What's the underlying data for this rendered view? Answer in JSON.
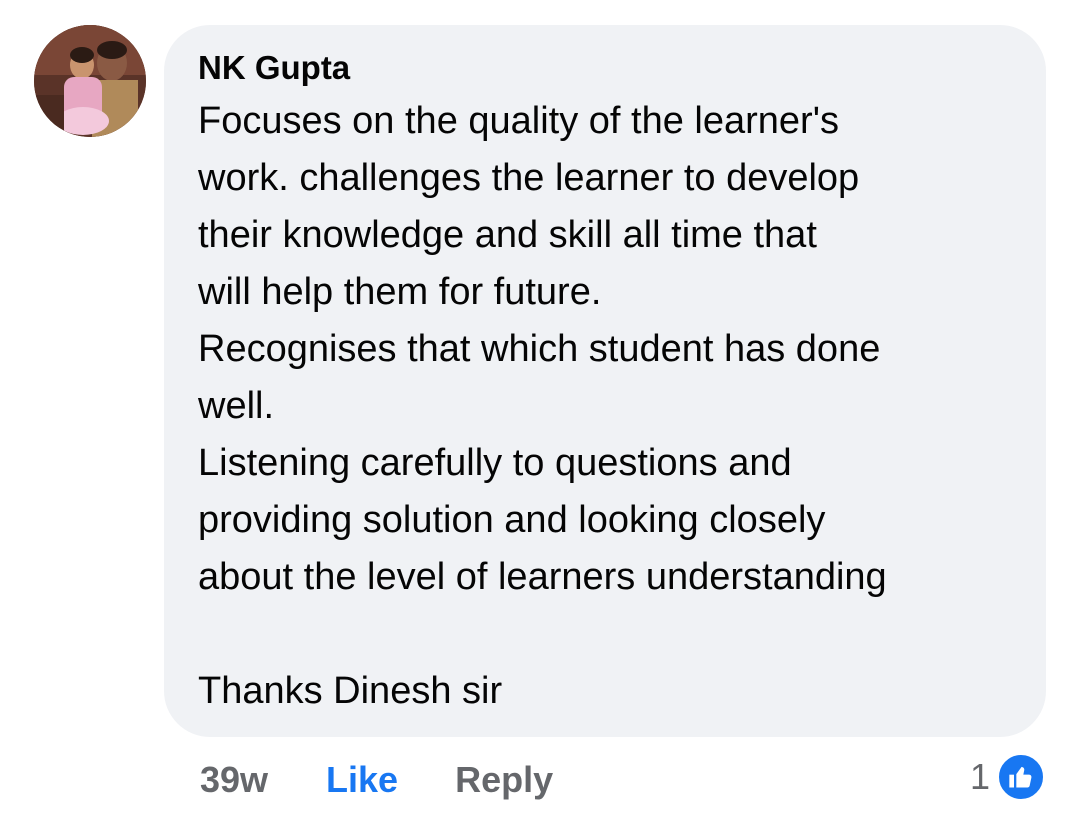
{
  "comment": {
    "author": "NK Gupta",
    "body_lines": [
      "Focuses on the quality of the learner's",
      "work. challenges the learner to develop",
      "their knowledge and skill all time that",
      "will help them for future.",
      "Recognises that which student has done",
      "well.",
      "Listening carefully to questions and",
      "providing solution and looking closely",
      "about the level of learners understanding",
      "",
      "Thanks Dinesh sir"
    ],
    "timestamp": "39w",
    "like_label": "Like",
    "reply_label": "Reply",
    "reaction_count": "1",
    "reaction_icon": "thumbs-up-icon"
  },
  "colors": {
    "bubble_bg": "#f0f2f5",
    "text": "#050505",
    "muted": "#65676b",
    "accent": "#1877f2"
  }
}
